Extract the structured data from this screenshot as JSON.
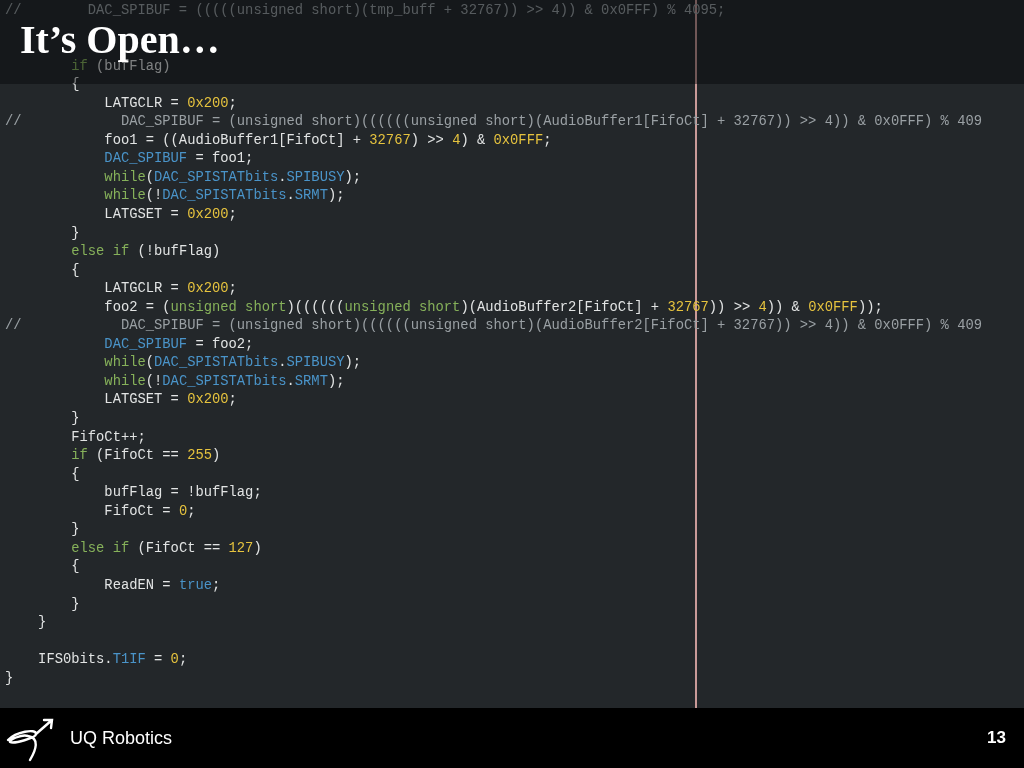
{
  "slide_title": "It’s Open…",
  "code_lines": [
    {
      "kind": "code",
      "tokens": [
        {
          "text": "//        DAC_SPIBUF = (((((unsigned short)(tmp_buff + 32767)) >> 4)) & 0x0FFF) % 4095;",
          "kind": "comment"
        }
      ]
    },
    {
      "kind": "blank"
    },
    {
      "kind": "blank"
    },
    {
      "kind": "code",
      "tokens": [
        {
          "text": "        if",
          "kind": "keyword"
        },
        {
          "text": " (bufFlag)",
          "kind": "plain"
        }
      ]
    },
    {
      "kind": "code",
      "tokens": [
        {
          "text": "        {",
          "kind": "plain"
        }
      ]
    },
    {
      "kind": "code",
      "tokens": [
        {
          "text": "            LATGCLR = ",
          "kind": "plain"
        },
        {
          "text": "0x200",
          "kind": "number"
        },
        {
          "text": ";",
          "kind": "plain"
        }
      ]
    },
    {
      "kind": "code",
      "tokens": [
        {
          "text": "//            DAC_SPIBUF = (unsigned short)((((((unsigned short)(AudioBuffer1[FifoCt] + 32767)) >> 4)) & 0x0FFF) % 409",
          "kind": "comment"
        }
      ]
    },
    {
      "kind": "code",
      "tokens": [
        {
          "text": "            foo1 = ((AudioBuffer1[FifoCt] + ",
          "kind": "plain"
        },
        {
          "text": "32767",
          "kind": "number"
        },
        {
          "text": ") >> ",
          "kind": "plain"
        },
        {
          "text": "4",
          "kind": "number"
        },
        {
          "text": ") & ",
          "kind": "plain"
        },
        {
          "text": "0x0FFF",
          "kind": "number"
        },
        {
          "text": ";",
          "kind": "plain"
        }
      ]
    },
    {
      "kind": "code",
      "tokens": [
        {
          "text": "            DAC_SPIBUF",
          "kind": "macro"
        },
        {
          "text": " = foo1;",
          "kind": "plain"
        }
      ]
    },
    {
      "kind": "code",
      "tokens": [
        {
          "text": "            while",
          "kind": "keyword"
        },
        {
          "text": "(",
          "kind": "plain"
        },
        {
          "text": "DAC_SPISTATbits",
          "kind": "macro"
        },
        {
          "text": ".",
          "kind": "plain"
        },
        {
          "text": "SPIBUSY",
          "kind": "macro"
        },
        {
          "text": ");",
          "kind": "plain"
        }
      ]
    },
    {
      "kind": "code",
      "tokens": [
        {
          "text": "            while",
          "kind": "keyword"
        },
        {
          "text": "(!",
          "kind": "plain"
        },
        {
          "text": "DAC_SPISTATbits",
          "kind": "macro"
        },
        {
          "text": ".",
          "kind": "plain"
        },
        {
          "text": "SRMT",
          "kind": "macro"
        },
        {
          "text": ");",
          "kind": "plain"
        }
      ]
    },
    {
      "kind": "code",
      "tokens": [
        {
          "text": "            LATGSET = ",
          "kind": "plain"
        },
        {
          "text": "0x200",
          "kind": "number"
        },
        {
          "text": ";",
          "kind": "plain"
        }
      ]
    },
    {
      "kind": "code",
      "tokens": [
        {
          "text": "        }",
          "kind": "plain"
        }
      ]
    },
    {
      "kind": "code",
      "tokens": [
        {
          "text": "        else if",
          "kind": "keyword"
        },
        {
          "text": " (!bufFlag)",
          "kind": "plain"
        }
      ]
    },
    {
      "kind": "code",
      "tokens": [
        {
          "text": "        {",
          "kind": "plain"
        }
      ]
    },
    {
      "kind": "code",
      "tokens": [
        {
          "text": "            LATGCLR = ",
          "kind": "plain"
        },
        {
          "text": "0x200",
          "kind": "number"
        },
        {
          "text": ";",
          "kind": "plain"
        }
      ]
    },
    {
      "kind": "code",
      "tokens": [
        {
          "text": "            foo2 = (",
          "kind": "plain"
        },
        {
          "text": "unsigned short",
          "kind": "keyword"
        },
        {
          "text": ")((((((",
          "kind": "plain"
        },
        {
          "text": "unsigned short",
          "kind": "keyword"
        },
        {
          "text": ")(AudioBuffer2[FifoCt] + ",
          "kind": "plain"
        },
        {
          "text": "32767",
          "kind": "number"
        },
        {
          "text": ")) >> ",
          "kind": "plain"
        },
        {
          "text": "4",
          "kind": "number"
        },
        {
          "text": ")) & ",
          "kind": "plain"
        },
        {
          "text": "0x0FFF",
          "kind": "number"
        },
        {
          "text": "));",
          "kind": "plain"
        }
      ]
    },
    {
      "kind": "code",
      "tokens": [
        {
          "text": "//            DAC_SPIBUF = (unsigned short)((((((unsigned short)(AudioBuffer2[FifoCt] + 32767)) >> 4)) & 0x0FFF) % 409",
          "kind": "comment"
        }
      ]
    },
    {
      "kind": "code",
      "tokens": [
        {
          "text": "            DAC_SPIBUF",
          "kind": "macro"
        },
        {
          "text": " = foo2;",
          "kind": "plain"
        }
      ]
    },
    {
      "kind": "code",
      "tokens": [
        {
          "text": "            while",
          "kind": "keyword"
        },
        {
          "text": "(",
          "kind": "plain"
        },
        {
          "text": "DAC_SPISTATbits",
          "kind": "macro"
        },
        {
          "text": ".",
          "kind": "plain"
        },
        {
          "text": "SPIBUSY",
          "kind": "macro"
        },
        {
          "text": ");",
          "kind": "plain"
        }
      ]
    },
    {
      "kind": "code",
      "tokens": [
        {
          "text": "            while",
          "kind": "keyword"
        },
        {
          "text": "(!",
          "kind": "plain"
        },
        {
          "text": "DAC_SPISTATbits",
          "kind": "macro"
        },
        {
          "text": ".",
          "kind": "plain"
        },
        {
          "text": "SRMT",
          "kind": "macro"
        },
        {
          "text": ");",
          "kind": "plain"
        }
      ]
    },
    {
      "kind": "code",
      "tokens": [
        {
          "text": "            LATGSET = ",
          "kind": "plain"
        },
        {
          "text": "0x200",
          "kind": "number"
        },
        {
          "text": ";",
          "kind": "plain"
        }
      ]
    },
    {
      "kind": "code",
      "tokens": [
        {
          "text": "        }",
          "kind": "plain"
        }
      ]
    },
    {
      "kind": "code",
      "tokens": [
        {
          "text": "        FifoCt++;",
          "kind": "plain"
        }
      ]
    },
    {
      "kind": "code",
      "tokens": [
        {
          "text": "        if",
          "kind": "keyword"
        },
        {
          "text": " (FifoCt == ",
          "kind": "plain"
        },
        {
          "text": "255",
          "kind": "number"
        },
        {
          "text": ")",
          "kind": "plain"
        }
      ]
    },
    {
      "kind": "code",
      "tokens": [
        {
          "text": "        {",
          "kind": "plain"
        }
      ]
    },
    {
      "kind": "code",
      "tokens": [
        {
          "text": "            bufFlag = !bufFlag;",
          "kind": "plain"
        }
      ]
    },
    {
      "kind": "code",
      "tokens": [
        {
          "text": "            FifoCt = ",
          "kind": "plain"
        },
        {
          "text": "0",
          "kind": "number"
        },
        {
          "text": ";",
          "kind": "plain"
        }
      ]
    },
    {
      "kind": "code",
      "tokens": [
        {
          "text": "        }",
          "kind": "plain"
        }
      ]
    },
    {
      "kind": "code",
      "tokens": [
        {
          "text": "        else if",
          "kind": "keyword"
        },
        {
          "text": " (FifoCt == ",
          "kind": "plain"
        },
        {
          "text": "127",
          "kind": "number"
        },
        {
          "text": ")",
          "kind": "plain"
        }
      ]
    },
    {
      "kind": "code",
      "tokens": [
        {
          "text": "        {",
          "kind": "plain"
        }
      ]
    },
    {
      "kind": "code",
      "tokens": [
        {
          "text": "            ReadEN = ",
          "kind": "plain"
        },
        {
          "text": "true",
          "kind": "macro"
        },
        {
          "text": ";",
          "kind": "plain"
        }
      ]
    },
    {
      "kind": "code",
      "tokens": [
        {
          "text": "        }",
          "kind": "plain"
        }
      ]
    },
    {
      "kind": "code",
      "tokens": [
        {
          "text": "    }",
          "kind": "plain"
        }
      ]
    },
    {
      "kind": "blank"
    },
    {
      "kind": "code",
      "tokens": [
        {
          "text": "    IFS0bits.",
          "kind": "plain"
        },
        {
          "text": "T1IF",
          "kind": "macro"
        },
        {
          "text": " = ",
          "kind": "plain"
        },
        {
          "text": "0",
          "kind": "number"
        },
        {
          "text": ";",
          "kind": "plain"
        }
      ]
    },
    {
      "kind": "code",
      "tokens": [
        {
          "text": "}",
          "kind": "plain"
        }
      ]
    }
  ],
  "footer": {
    "organization": "UQ Robotics",
    "page_number": "13"
  }
}
